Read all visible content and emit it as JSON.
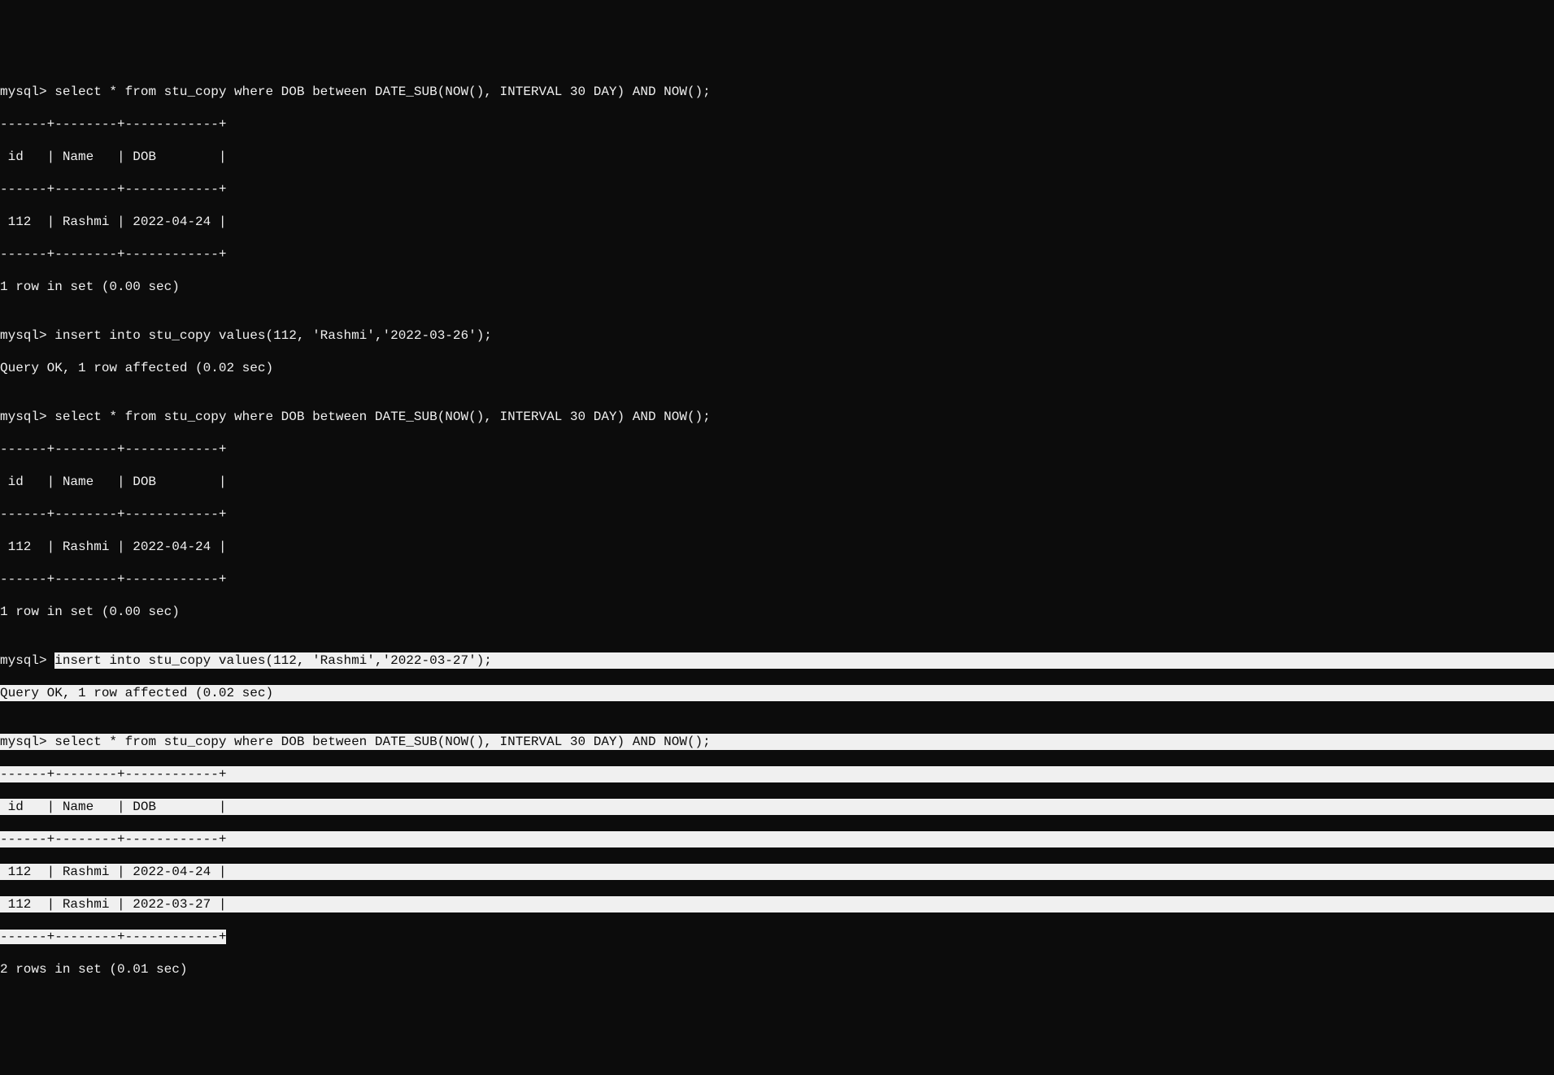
{
  "block1": {
    "prompt": "mysql> ",
    "query": "select * from stu_copy where DOB between DATE_SUB(NOW(), INTERVAL 30 DAY) AND NOW();",
    "sep": "------+--------+------------+",
    "header": " id   | Name   | DOB        |",
    "row": " 112  | Rashmi | 2022-04-24 |",
    "status": "1 row in set (0.00 sec)"
  },
  "block2": {
    "prompt": "mysql> ",
    "query": "insert into stu_copy values(112, 'Rashmi','2022-03-26');",
    "status": "Query OK, 1 row affected (0.02 sec)"
  },
  "block3": {
    "prompt": "mysql> ",
    "query": "select * from stu_copy where DOB between DATE_SUB(NOW(), INTERVAL 30 DAY) AND NOW();",
    "sep": "------+--------+------------+",
    "header": " id   | Name   | DOB        |",
    "row": " 112  | Rashmi | 2022-04-24 |",
    "status": "1 row in set (0.00 sec)"
  },
  "block4": {
    "prompt": "mysql> ",
    "query": "insert into stu_copy values(112, 'Rashmi','2022-03-27');",
    "status": "Query OK, 1 row affected (0.02 sec)"
  },
  "block5": {
    "prompt": "mysql> ",
    "query": "select * from stu_copy where DOB between DATE_SUB(NOW(), INTERVAL 30 DAY) AND NOW();",
    "sep": "------+--------+------------+",
    "header": " id   | Name   | DOB        |",
    "row1": " 112  | Rashmi | 2022-04-24 |",
    "row2": " 112  | Rashmi | 2022-03-27 |",
    "status": "2 rows in set (0.01 sec)"
  },
  "blank": ""
}
